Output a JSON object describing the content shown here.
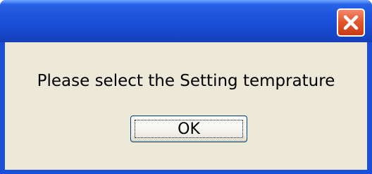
{
  "dialog": {
    "message": "Please select the Setting temprature",
    "ok_label": "OK",
    "close_icon": "close-x-icon"
  },
  "colors": {
    "titlebar": "#1f56de",
    "close_button": "#e4582f",
    "client_background": "#ece9d8"
  }
}
